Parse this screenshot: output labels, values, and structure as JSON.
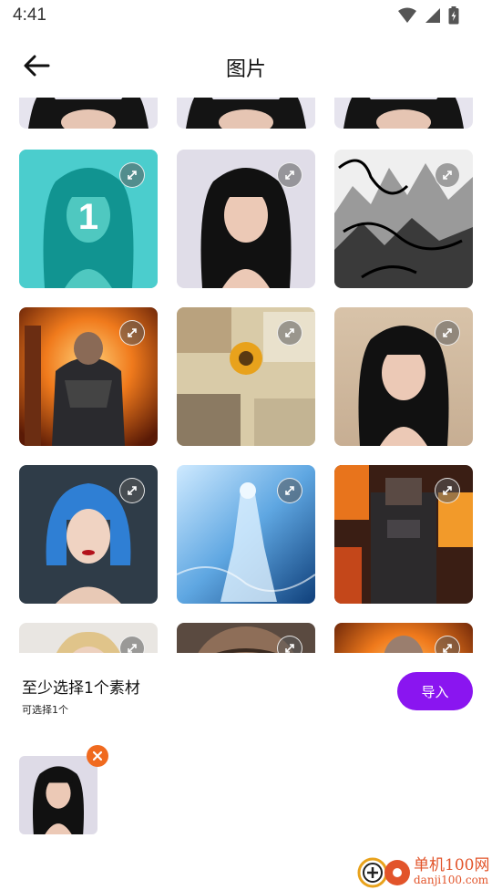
{
  "status_bar": {
    "time": "4:41"
  },
  "header": {
    "title": "图片"
  },
  "grid": {
    "tiles": [
      {
        "subject": "woman-black-hair",
        "selected": true,
        "selection_number": "1"
      },
      {
        "subject": "woman-black-hair"
      },
      {
        "subject": "ink-mountains"
      },
      {
        "subject": "armored-warrior-fire"
      },
      {
        "subject": "collage-sunflower"
      },
      {
        "subject": "woman-black-hair"
      },
      {
        "subject": "woman-blue-hair"
      },
      {
        "subject": "ethereal-figure-blue"
      },
      {
        "subject": "pixelated-warrior-fire"
      },
      {
        "subject": "blonde-portrait"
      },
      {
        "subject": "elderly-man"
      },
      {
        "subject": "anime-warrior-fire"
      }
    ]
  },
  "footer": {
    "hint_title": "至少选择1个素材",
    "hint_subtitle": "可选择1个",
    "import_label": "导入"
  },
  "colors": {
    "accent": "#8a15f0",
    "selection": "#19d6cf",
    "remove": "#f06a1f",
    "watermark": "#e2542a"
  },
  "watermark": {
    "line1": "单机100网",
    "line2": "danji100.com"
  }
}
